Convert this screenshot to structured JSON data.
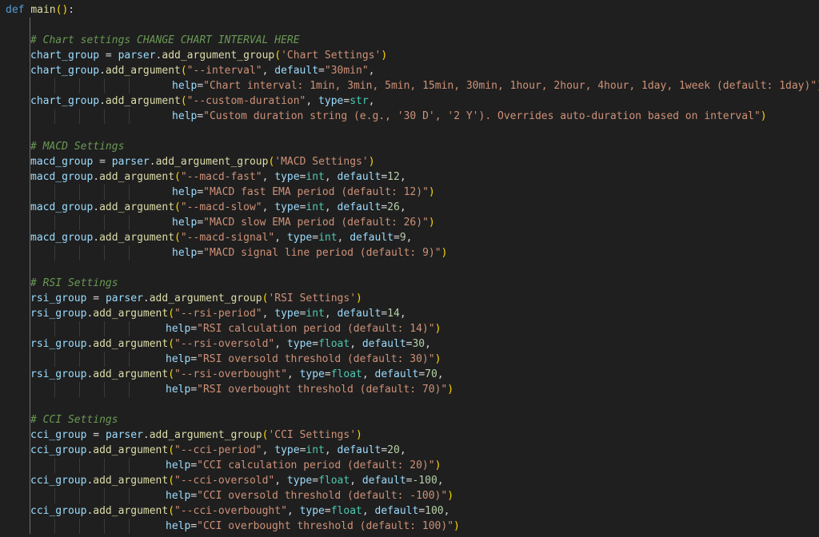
{
  "editor": {
    "language": "python",
    "colors": {
      "background": "#1f1f1f",
      "keyword": "#569cd6",
      "function": "#dcdcaa",
      "variable": "#9cdcfe",
      "string": "#ce9178",
      "number": "#b5cea8",
      "comment": "#6a9955",
      "operator": "#d4d4d4",
      "bracket_level_1": "#ffd700",
      "bracket_level_2": "#da70d6",
      "type": "#4ec9b0"
    },
    "lines": [
      {
        "indent": 0,
        "tokens": [
          [
            "kw",
            "def"
          ],
          [
            "op",
            " "
          ],
          [
            "fn",
            "main"
          ],
          [
            "p1",
            "()"
          ],
          [
            "op",
            ":"
          ]
        ]
      },
      {
        "indent": 1,
        "tokens": []
      },
      {
        "indent": 1,
        "tokens": [
          [
            "cm",
            "# Chart settings CHANGE CHART INTERVAL HERE"
          ]
        ]
      },
      {
        "indent": 1,
        "tokens": [
          [
            "var",
            "chart_group"
          ],
          [
            "op",
            " = "
          ],
          [
            "var",
            "parser"
          ],
          [
            "op",
            "."
          ],
          [
            "fn",
            "add_argument_group"
          ],
          [
            "p1",
            "("
          ],
          [
            "str",
            "'Chart Settings'"
          ],
          [
            "p1",
            ")"
          ]
        ]
      },
      {
        "indent": 1,
        "tokens": [
          [
            "var",
            "chart_group"
          ],
          [
            "op",
            "."
          ],
          [
            "fn",
            "add_argument"
          ],
          [
            "p1",
            "("
          ],
          [
            "str",
            "\"--interval\""
          ],
          [
            "op",
            ", "
          ],
          [
            "var",
            "default"
          ],
          [
            "op",
            "="
          ],
          [
            "str",
            "\"30min\""
          ],
          [
            "op",
            ","
          ]
        ]
      },
      {
        "indent": 1,
        "cont": 2,
        "tokens": [
          [
            "var",
            "help"
          ],
          [
            "op",
            "="
          ],
          [
            "str",
            "\"Chart interval: 1min, 3min, 5min, 15min, 30min, 1hour, 2hour, 4hour, 1day, 1week (default: 1day)\""
          ],
          [
            "p1",
            ")"
          ]
        ]
      },
      {
        "indent": 1,
        "tokens": [
          [
            "var",
            "chart_group"
          ],
          [
            "op",
            "."
          ],
          [
            "fn",
            "add_argument"
          ],
          [
            "p1",
            "("
          ],
          [
            "str",
            "\"--custom-duration\""
          ],
          [
            "op",
            ", "
          ],
          [
            "var",
            "type"
          ],
          [
            "op",
            "="
          ],
          [
            "type",
            "str"
          ],
          [
            "op",
            ","
          ]
        ]
      },
      {
        "indent": 1,
        "cont": 2,
        "tokens": [
          [
            "var",
            "help"
          ],
          [
            "op",
            "="
          ],
          [
            "str",
            "\"Custom duration string (e.g., '30 D', '2 Y'). Overrides auto-duration based on interval\""
          ],
          [
            "p1",
            ")"
          ]
        ]
      },
      {
        "indent": 1,
        "tokens": []
      },
      {
        "indent": 1,
        "tokens": [
          [
            "cm",
            "# MACD Settings"
          ]
        ]
      },
      {
        "indent": 1,
        "tokens": [
          [
            "var",
            "macd_group"
          ],
          [
            "op",
            " = "
          ],
          [
            "var",
            "parser"
          ],
          [
            "op",
            "."
          ],
          [
            "fn",
            "add_argument_group"
          ],
          [
            "p1",
            "("
          ],
          [
            "str",
            "'MACD Settings'"
          ],
          [
            "p1",
            ")"
          ]
        ]
      },
      {
        "indent": 1,
        "tokens": [
          [
            "var",
            "macd_group"
          ],
          [
            "op",
            "."
          ],
          [
            "fn",
            "add_argument"
          ],
          [
            "p1",
            "("
          ],
          [
            "str",
            "\"--macd-fast\""
          ],
          [
            "op",
            ", "
          ],
          [
            "var",
            "type"
          ],
          [
            "op",
            "="
          ],
          [
            "type",
            "int"
          ],
          [
            "op",
            ", "
          ],
          [
            "var",
            "default"
          ],
          [
            "op",
            "="
          ],
          [
            "num",
            "12"
          ],
          [
            "op",
            ","
          ]
        ]
      },
      {
        "indent": 1,
        "cont": 2,
        "tokens": [
          [
            "var",
            "help"
          ],
          [
            "op",
            "="
          ],
          [
            "str",
            "\"MACD fast EMA period (default: 12)\""
          ],
          [
            "p1",
            ")"
          ]
        ]
      },
      {
        "indent": 1,
        "tokens": [
          [
            "var",
            "macd_group"
          ],
          [
            "op",
            "."
          ],
          [
            "fn",
            "add_argument"
          ],
          [
            "p1",
            "("
          ],
          [
            "str",
            "\"--macd-slow\""
          ],
          [
            "op",
            ", "
          ],
          [
            "var",
            "type"
          ],
          [
            "op",
            "="
          ],
          [
            "type",
            "int"
          ],
          [
            "op",
            ", "
          ],
          [
            "var",
            "default"
          ],
          [
            "op",
            "="
          ],
          [
            "num",
            "26"
          ],
          [
            "op",
            ","
          ]
        ]
      },
      {
        "indent": 1,
        "cont": 2,
        "tokens": [
          [
            "var",
            "help"
          ],
          [
            "op",
            "="
          ],
          [
            "str",
            "\"MACD slow EMA period (default: 26)\""
          ],
          [
            "p1",
            ")"
          ]
        ]
      },
      {
        "indent": 1,
        "tokens": [
          [
            "var",
            "macd_group"
          ],
          [
            "op",
            "."
          ],
          [
            "fn",
            "add_argument"
          ],
          [
            "p1",
            "("
          ],
          [
            "str",
            "\"--macd-signal\""
          ],
          [
            "op",
            ", "
          ],
          [
            "var",
            "type"
          ],
          [
            "op",
            "="
          ],
          [
            "type",
            "int"
          ],
          [
            "op",
            ", "
          ],
          [
            "var",
            "default"
          ],
          [
            "op",
            "="
          ],
          [
            "num",
            "9"
          ],
          [
            "op",
            ","
          ]
        ]
      },
      {
        "indent": 1,
        "cont": 2,
        "tokens": [
          [
            "var",
            "help"
          ],
          [
            "op",
            "="
          ],
          [
            "str",
            "\"MACD signal line period (default: 9)\""
          ],
          [
            "p1",
            ")"
          ]
        ]
      },
      {
        "indent": 1,
        "tokens": []
      },
      {
        "indent": 1,
        "tokens": [
          [
            "cm",
            "# RSI Settings"
          ]
        ]
      },
      {
        "indent": 1,
        "tokens": [
          [
            "var",
            "rsi_group"
          ],
          [
            "op",
            " = "
          ],
          [
            "var",
            "parser"
          ],
          [
            "op",
            "."
          ],
          [
            "fn",
            "add_argument_group"
          ],
          [
            "p1",
            "("
          ],
          [
            "str",
            "'RSI Settings'"
          ],
          [
            "p1",
            ")"
          ]
        ]
      },
      {
        "indent": 1,
        "tokens": [
          [
            "var",
            "rsi_group"
          ],
          [
            "op",
            "."
          ],
          [
            "fn",
            "add_argument"
          ],
          [
            "p1",
            "("
          ],
          [
            "str",
            "\"--rsi-period\""
          ],
          [
            "op",
            ", "
          ],
          [
            "var",
            "type"
          ],
          [
            "op",
            "="
          ],
          [
            "type",
            "int"
          ],
          [
            "op",
            ", "
          ],
          [
            "var",
            "default"
          ],
          [
            "op",
            "="
          ],
          [
            "num",
            "14"
          ],
          [
            "op",
            ","
          ]
        ]
      },
      {
        "indent": 1,
        "cont": 1,
        "tokens": [
          [
            "var",
            "help"
          ],
          [
            "op",
            "="
          ],
          [
            "str",
            "\"RSI calculation period (default: 14)\""
          ],
          [
            "p1",
            ")"
          ]
        ]
      },
      {
        "indent": 1,
        "tokens": [
          [
            "var",
            "rsi_group"
          ],
          [
            "op",
            "."
          ],
          [
            "fn",
            "add_argument"
          ],
          [
            "p1",
            "("
          ],
          [
            "str",
            "\"--rsi-oversold\""
          ],
          [
            "op",
            ", "
          ],
          [
            "var",
            "type"
          ],
          [
            "op",
            "="
          ],
          [
            "type",
            "float"
          ],
          [
            "op",
            ", "
          ],
          [
            "var",
            "default"
          ],
          [
            "op",
            "="
          ],
          [
            "num",
            "30"
          ],
          [
            "op",
            ","
          ]
        ]
      },
      {
        "indent": 1,
        "cont": 1,
        "tokens": [
          [
            "var",
            "help"
          ],
          [
            "op",
            "="
          ],
          [
            "str",
            "\"RSI oversold threshold (default: 30)\""
          ],
          [
            "p1",
            ")"
          ]
        ]
      },
      {
        "indent": 1,
        "tokens": [
          [
            "var",
            "rsi_group"
          ],
          [
            "op",
            "."
          ],
          [
            "fn",
            "add_argument"
          ],
          [
            "p1",
            "("
          ],
          [
            "str",
            "\"--rsi-overbought\""
          ],
          [
            "op",
            ", "
          ],
          [
            "var",
            "type"
          ],
          [
            "op",
            "="
          ],
          [
            "type",
            "float"
          ],
          [
            "op",
            ", "
          ],
          [
            "var",
            "default"
          ],
          [
            "op",
            "="
          ],
          [
            "num",
            "70"
          ],
          [
            "op",
            ","
          ]
        ]
      },
      {
        "indent": 1,
        "cont": 1,
        "tokens": [
          [
            "var",
            "help"
          ],
          [
            "op",
            "="
          ],
          [
            "str",
            "\"RSI overbought threshold (default: 70)\""
          ],
          [
            "p1",
            ")"
          ]
        ]
      },
      {
        "indent": 1,
        "tokens": []
      },
      {
        "indent": 1,
        "tokens": [
          [
            "cm",
            "# CCI Settings"
          ]
        ]
      },
      {
        "indent": 1,
        "tokens": [
          [
            "var",
            "cci_group"
          ],
          [
            "op",
            " = "
          ],
          [
            "var",
            "parser"
          ],
          [
            "op",
            "."
          ],
          [
            "fn",
            "add_argument_group"
          ],
          [
            "p1",
            "("
          ],
          [
            "str",
            "'CCI Settings'"
          ],
          [
            "p1",
            ")"
          ]
        ]
      },
      {
        "indent": 1,
        "tokens": [
          [
            "var",
            "cci_group"
          ],
          [
            "op",
            "."
          ],
          [
            "fn",
            "add_argument"
          ],
          [
            "p1",
            "("
          ],
          [
            "str",
            "\"--cci-period\""
          ],
          [
            "op",
            ", "
          ],
          [
            "var",
            "type"
          ],
          [
            "op",
            "="
          ],
          [
            "type",
            "int"
          ],
          [
            "op",
            ", "
          ],
          [
            "var",
            "default"
          ],
          [
            "op",
            "="
          ],
          [
            "num",
            "20"
          ],
          [
            "op",
            ","
          ]
        ]
      },
      {
        "indent": 1,
        "cont": 1,
        "tokens": [
          [
            "var",
            "help"
          ],
          [
            "op",
            "="
          ],
          [
            "str",
            "\"CCI calculation period (default: 20)\""
          ],
          [
            "p1",
            ")"
          ]
        ]
      },
      {
        "indent": 1,
        "tokens": [
          [
            "var",
            "cci_group"
          ],
          [
            "op",
            "."
          ],
          [
            "fn",
            "add_argument"
          ],
          [
            "p1",
            "("
          ],
          [
            "str",
            "\"--cci-oversold\""
          ],
          [
            "op",
            ", "
          ],
          [
            "var",
            "type"
          ],
          [
            "op",
            "="
          ],
          [
            "type",
            "float"
          ],
          [
            "op",
            ", "
          ],
          [
            "var",
            "default"
          ],
          [
            "op",
            "="
          ],
          [
            "num",
            "-100"
          ],
          [
            "op",
            ","
          ]
        ]
      },
      {
        "indent": 1,
        "cont": 1,
        "tokens": [
          [
            "var",
            "help"
          ],
          [
            "op",
            "="
          ],
          [
            "str",
            "\"CCI oversold threshold (default: -100)\""
          ],
          [
            "p1",
            ")"
          ]
        ]
      },
      {
        "indent": 1,
        "tokens": [
          [
            "var",
            "cci_group"
          ],
          [
            "op",
            "."
          ],
          [
            "fn",
            "add_argument"
          ],
          [
            "p1",
            "("
          ],
          [
            "str",
            "\"--cci-overbought\""
          ],
          [
            "op",
            ", "
          ],
          [
            "var",
            "type"
          ],
          [
            "op",
            "="
          ],
          [
            "type",
            "float"
          ],
          [
            "op",
            ", "
          ],
          [
            "var",
            "default"
          ],
          [
            "op",
            "="
          ],
          [
            "num",
            "100"
          ],
          [
            "op",
            ","
          ]
        ]
      },
      {
        "indent": 1,
        "cont": 1,
        "tokens": [
          [
            "var",
            "help"
          ],
          [
            "op",
            "="
          ],
          [
            "str",
            "\"CCI overbought threshold (default: 100)\""
          ],
          [
            "p1",
            ")"
          ]
        ]
      }
    ]
  }
}
